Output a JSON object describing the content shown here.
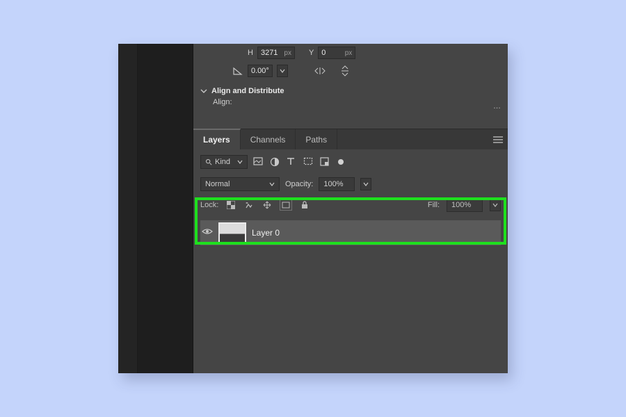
{
  "transform": {
    "h_label": "H",
    "h_value": "3271",
    "h_unit": "px",
    "y_label": "Y",
    "y_value": "0",
    "y_unit": "px",
    "rotate_value": "0.00°"
  },
  "align_section": {
    "title": "Align and Distribute",
    "align_label": "Align:"
  },
  "tabs": [
    {
      "label": "Layers",
      "active": true
    },
    {
      "label": "Channels",
      "active": false
    },
    {
      "label": "Paths",
      "active": false
    }
  ],
  "filter": {
    "kind_label": "Kind"
  },
  "blend": {
    "mode": "Normal",
    "opacity_label": "Opacity:",
    "opacity_value": "100%"
  },
  "lock": {
    "label": "Lock:",
    "fill_label": "Fill:",
    "fill_value": "100%"
  },
  "layers": [
    {
      "name": "Layer 0",
      "visible": true
    }
  ]
}
